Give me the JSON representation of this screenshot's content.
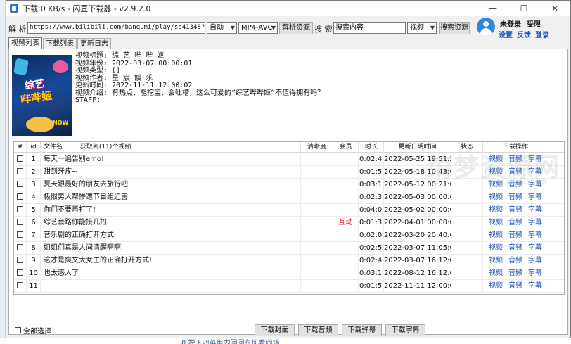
{
  "window": {
    "title": "下载:0 KB/s - 闪豆下载器 - v2.9.2.0",
    "controls": [
      "—",
      "☐",
      "✕"
    ]
  },
  "toolbar": {
    "parse_label": "解 析:",
    "url_value": "https://www.bilibili.com/bangumi/play/ss41348?spm_id_fro",
    "quality_value": "自动",
    "format_value": "MP4-AVC",
    "parse_button": "解析资源",
    "search_label": "搜 索:",
    "search_value": "搜索内容",
    "search_type_value": "视频",
    "search_button": "搜索资源"
  },
  "user": {
    "status": "未登录",
    "privilege": "受限",
    "links": [
      "设置",
      "反馈",
      "登录"
    ]
  },
  "tabs": [
    "视频列表",
    "下载列表",
    "更新日志"
  ],
  "cover": {
    "line1": "综艺",
    "line2": "哔哔姬",
    "badge": "NOW"
  },
  "info": {
    "title": "视频标题: 综 艺 哔 哔 姬",
    "year": "视频年份: 2022-03-07 00:00:01",
    "type": "视频类型: []",
    "author": "视频作者: 星 宸 娱 乐",
    "updated": "更新时间: 2022-11-11 12:00:02",
    "intro": "视频介绍: 有热点、能挖宝、会吐槽，这么可爱的“综艺哔哔姬”不值得拥有吗？",
    "staff": "STAFF:"
  },
  "table": {
    "headers": {
      "check": "#",
      "id": "id",
      "name": "文件名",
      "fetched": "获取到(11)个视频",
      "clarity": "清晰度",
      "member": "会员",
      "duration": "时长",
      "date": "更新日期时间",
      "state": "状态",
      "ops": "下载操作"
    },
    "ops_labels": [
      "视频",
      "音频",
      "字幕"
    ],
    "rows": [
      {
        "id": "1",
        "name": "每天一遍告别emo!",
        "member": "",
        "duration": "0:02:4",
        "date": "2022-05-25 19:51:29"
      },
      {
        "id": "2",
        "name": "甜到牙疼~",
        "member": "",
        "duration": "0:01:5",
        "date": "2022-05-18 10:43:00"
      },
      {
        "id": "3",
        "name": "夏天跟最好的朋友去旅行吧",
        "member": "",
        "duration": "0:03:1",
        "date": "2022-05-12 00:21:00"
      },
      {
        "id": "4",
        "name": "极限男人帮惨遭节目组迫害",
        "member": "",
        "duration": "0:02:3",
        "date": "2022-05-03 00:00:00"
      },
      {
        "id": "5",
        "name": "你们不要再打了!",
        "member": "",
        "duration": "0:04:0",
        "date": "2022-05-02 00:00:00"
      },
      {
        "id": "6",
        "name": "综艺套路你能接几招",
        "member": "互动",
        "duration": "0:01:3",
        "date": "2022-04-01 00:00:00"
      },
      {
        "id": "7",
        "name": "音乐剧的正确打开方式",
        "member": "",
        "duration": "0:02:0",
        "date": "2022-03-20 20:40:00"
      },
      {
        "id": "8",
        "name": "姐姐们真是人间清醒啊啊",
        "member": "",
        "duration": "0:02:5",
        "date": "2022-03-07 11:05:00"
      },
      {
        "id": "9",
        "name": "这才是爽文大女主的正确打开方式!",
        "member": "",
        "duration": "0:02:4",
        "date": "2022-03-07 16:12:00"
      },
      {
        "id": "10",
        "name": "也太惑人了",
        "member": "",
        "duration": "0:03:1",
        "date": "2022-08-12 16:12:00"
      },
      {
        "id": "11",
        "name": "",
        "member": "",
        "duration": "0:01:5",
        "date": "2022-11-11 12:00:02"
      }
    ]
  },
  "footer": {
    "select_all": "全部选择",
    "buttons": [
      "下载封面",
      "下载音频",
      "下载弹幕",
      "下载字幕"
    ]
  },
  "watermark": {
    "text": "绮梦资源网",
    "sub": "www.qmdat.com"
  },
  "background_snippet": "8  禅下四菜组内回回东风看闹场"
}
